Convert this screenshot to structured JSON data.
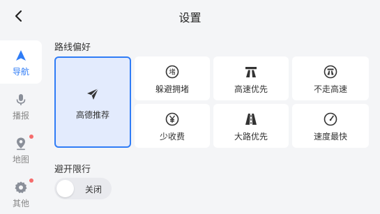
{
  "header": {
    "title": "设置"
  },
  "sidebar": {
    "items": [
      {
        "label": "导航",
        "icon": "navigation-arrow-icon",
        "active": true
      },
      {
        "label": "播报",
        "icon": "microphone-icon",
        "active": false
      },
      {
        "label": "地图",
        "icon": "map-pin-icon",
        "active": false,
        "badge": true
      },
      {
        "label": "其他",
        "icon": "gear-icon",
        "active": false,
        "badge": true
      }
    ]
  },
  "route_preference": {
    "title": "路线偏好",
    "options": [
      {
        "label": "高德推荐",
        "icon": "paper-plane-icon",
        "selected": true
      },
      {
        "label": "躲避拥堵",
        "icon": "congestion-icon",
        "selected": false
      },
      {
        "label": "高速优先",
        "icon": "highway-icon",
        "selected": false
      },
      {
        "label": "不走高速",
        "icon": "no-highway-icon",
        "selected": false
      },
      {
        "label": "少收费",
        "icon": "yuan-icon",
        "selected": false
      },
      {
        "label": "大路优先",
        "icon": "main-road-icon",
        "selected": false
      },
      {
        "label": "速度最快",
        "icon": "speedometer-icon",
        "selected": false
      }
    ]
  },
  "restriction": {
    "title": "避开限行",
    "toggle_label": "关闭",
    "enabled": false
  },
  "colors": {
    "accent": "#2f7cf6",
    "badge": "#f56c6c",
    "selected_bg": "#e3ebfd"
  }
}
